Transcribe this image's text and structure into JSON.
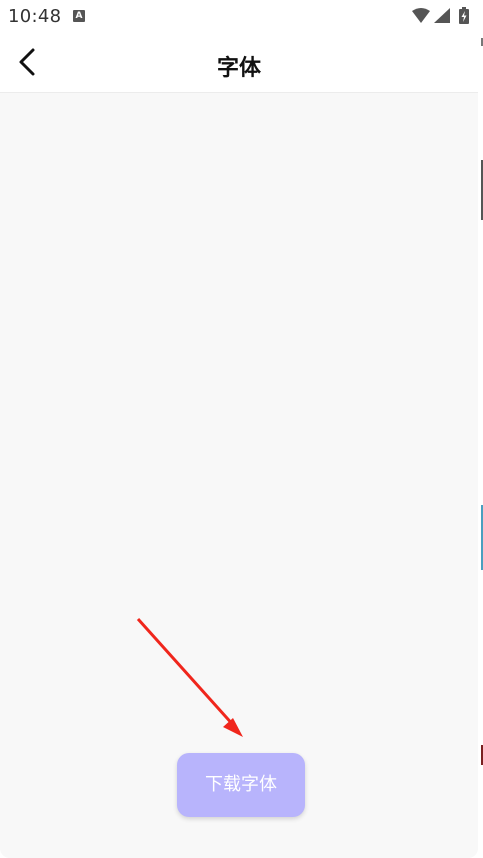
{
  "status_bar": {
    "time": "10:48",
    "notification_icon": "a-badge-icon",
    "icons": [
      "wifi-icon",
      "signal-icon",
      "battery-charging-icon"
    ]
  },
  "header": {
    "back_icon": "chevron-left-icon",
    "title": "字体"
  },
  "main": {
    "download_button_label": "下载字体"
  },
  "colors": {
    "accent_button": "#b8b4fc",
    "annotation_arrow": "#f0261c",
    "background": "#f8f8f8"
  }
}
